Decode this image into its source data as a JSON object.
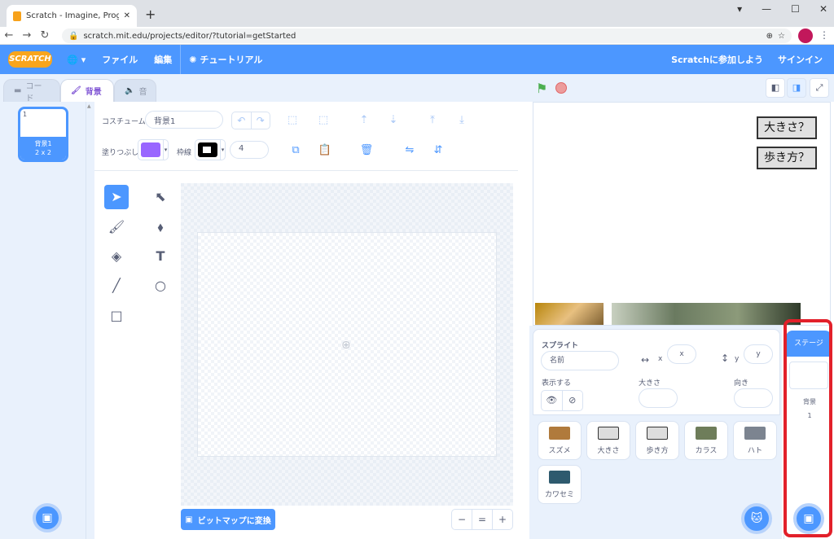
{
  "browser": {
    "tab_title": "Scratch - Imagine, Program, Shar",
    "new_tab": "+",
    "window_controls": [
      "▾",
      "—",
      "☐",
      "✕"
    ],
    "url": "scratch.mit.edu/projects/editor/?tutorial=getStarted"
  },
  "menubar": {
    "logo": "SCRATCH",
    "file": "ファイル",
    "edit": "編集",
    "tutorials": "チュートリアル",
    "join": "Scratchに参加しよう",
    "signin": "サインイン"
  },
  "editor_tabs": {
    "code": "コード",
    "costumes": "背景",
    "sounds": "音"
  },
  "costume_list": [
    {
      "index": "1",
      "name": "背景1",
      "size": "2 x 2"
    }
  ],
  "paint": {
    "costume_label": "コスチューム",
    "costume_name": "背景1",
    "fill_label": "塗りつぶし",
    "outline_label": "枠線",
    "outline_width": "4",
    "convert_button": "ビットマップに変換",
    "fill_color": "#9966ff",
    "outline_color": "#000000",
    "zoom_out": "−",
    "zoom_reset": "=",
    "zoom_in": "+"
  },
  "stage_buttons": [
    {
      "label": "大きさ？"
    },
    {
      "label": "歩き方？"
    }
  ],
  "sprite_info": {
    "sprite_label": "スプライト",
    "name_placeholder": "名前",
    "x_label": "x",
    "x_placeholder": "x",
    "y_label": "y",
    "y_placeholder": "y",
    "show_label": "表示する",
    "size_label": "大きさ",
    "direction_label": "向き"
  },
  "sprites": [
    {
      "name": "スズメ",
      "color": "#b07a3c"
    },
    {
      "name": "大きさ",
      "color": "#dddddd"
    },
    {
      "name": "歩き方",
      "color": "#dddddd"
    },
    {
      "name": "カラス",
      "color": "#6e7d5a"
    },
    {
      "name": "ハト",
      "color": "#7c8490"
    },
    {
      "name": "カワセミ",
      "color": "#2e5a6e"
    }
  ],
  "stage_pane": {
    "tab": "ステージ",
    "backdrop_label": "背景",
    "backdrop_count": "1"
  },
  "colors": {
    "accent": "#4c97ff",
    "highlight": "#e2202a"
  }
}
